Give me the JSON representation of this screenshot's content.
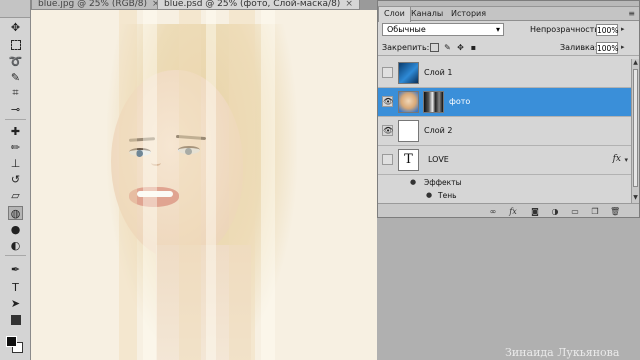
{
  "doc_tabs": [
    {
      "label": "blue.jpg @ 25% (RGB/8)",
      "close": "×",
      "active": false
    },
    {
      "label": "blue.psd @ 25% (фото, Слой-маска/8)",
      "close": "×",
      "active": true
    }
  ],
  "panel": {
    "tabs": [
      "Слои",
      "Каналы",
      "История"
    ],
    "menu_icon": "panel-menu-icon",
    "blend_mode": "Обычные",
    "opacity_label": "Непрозрачность:",
    "opacity_value": "100%",
    "lock_label": "Закрепить:",
    "fill_label": "Заливка:",
    "fill_value": "100%",
    "layers": [
      {
        "name": "Слой 1",
        "visible": false,
        "selected": false
      },
      {
        "name": "фото",
        "visible": true,
        "selected": true
      },
      {
        "name": "Слой 2",
        "visible": true,
        "selected": false
      },
      {
        "name": "LOVE",
        "visible": false,
        "selected": false,
        "thumb_text": "T",
        "fx": "fx"
      }
    ],
    "effects_label": "Эффекты",
    "effect_shadow": "Тень",
    "bottom_icons": [
      "link-icon",
      "fx-icon",
      "mask-icon",
      "adjustment-icon",
      "folder-icon",
      "new-layer-icon",
      "trash-icon"
    ]
  },
  "watermark": "Зинаида Лукьянова",
  "colors": {
    "selection": "#3a8fd9",
    "panel_bg": "#d6d6d6",
    "canvas_bg": "#f7f0e2"
  }
}
